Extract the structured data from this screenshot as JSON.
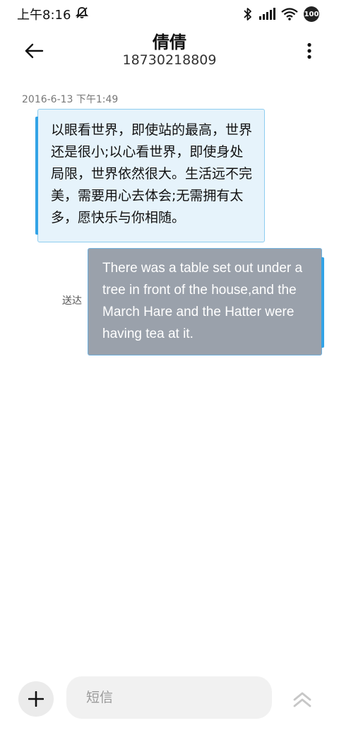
{
  "status_bar": {
    "time": "上午8:16",
    "icons": [
      "mute-icon",
      "bluetooth-icon",
      "signal-icon",
      "wifi-icon",
      "battery-icon"
    ],
    "battery_level": "100"
  },
  "header": {
    "contact_name": "倩倩",
    "contact_number": "18730218809",
    "back_icon": "arrow-left-icon",
    "more_icon": "more-vertical-icon"
  },
  "conversation": {
    "timestamp": "2016-6-13 下午1:49",
    "messages": [
      {
        "direction": "incoming",
        "text": "以眼看世界，即使站的最高，世界还是很小;以心看世界，即使身处局限，世界依然很大。生活远不完美，需要用心去体会;无需拥有太多，愿快乐与你相随。"
      },
      {
        "direction": "outgoing",
        "status": "送达",
        "text": "There was a table set out under a tree in front of the house,and the March Hare and the Hatter were having tea at it."
      }
    ]
  },
  "input_bar": {
    "placeholder": "短信",
    "add_icon": "plus-icon",
    "send_icon": "double-chevron-up-icon"
  },
  "colors": {
    "incoming_bubble": "#e6f3fb",
    "incoming_border": "#8ecdf0",
    "outgoing_bubble": "#9aa1ab",
    "accent": "#33a3e6"
  }
}
